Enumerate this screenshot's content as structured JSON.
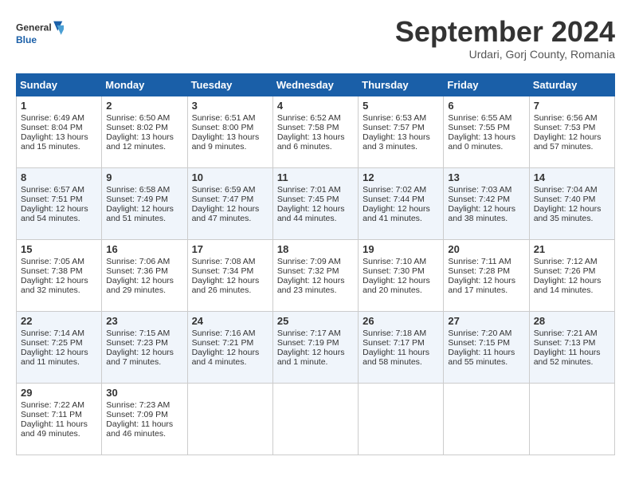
{
  "header": {
    "logo_line1": "General",
    "logo_line2": "Blue",
    "month": "September 2024",
    "location": "Urdari, Gorj County, Romania"
  },
  "weekdays": [
    "Sunday",
    "Monday",
    "Tuesday",
    "Wednesday",
    "Thursday",
    "Friday",
    "Saturday"
  ],
  "weeks": [
    [
      {
        "day": "1",
        "lines": [
          "Sunrise: 6:49 AM",
          "Sunset: 8:04 PM",
          "Daylight: 13 hours",
          "and 15 minutes."
        ]
      },
      {
        "day": "2",
        "lines": [
          "Sunrise: 6:50 AM",
          "Sunset: 8:02 PM",
          "Daylight: 13 hours",
          "and 12 minutes."
        ]
      },
      {
        "day": "3",
        "lines": [
          "Sunrise: 6:51 AM",
          "Sunset: 8:00 PM",
          "Daylight: 13 hours",
          "and 9 minutes."
        ]
      },
      {
        "day": "4",
        "lines": [
          "Sunrise: 6:52 AM",
          "Sunset: 7:58 PM",
          "Daylight: 13 hours",
          "and 6 minutes."
        ]
      },
      {
        "day": "5",
        "lines": [
          "Sunrise: 6:53 AM",
          "Sunset: 7:57 PM",
          "Daylight: 13 hours",
          "and 3 minutes."
        ]
      },
      {
        "day": "6",
        "lines": [
          "Sunrise: 6:55 AM",
          "Sunset: 7:55 PM",
          "Daylight: 13 hours",
          "and 0 minutes."
        ]
      },
      {
        "day": "7",
        "lines": [
          "Sunrise: 6:56 AM",
          "Sunset: 7:53 PM",
          "Daylight: 12 hours",
          "and 57 minutes."
        ]
      }
    ],
    [
      {
        "day": "8",
        "lines": [
          "Sunrise: 6:57 AM",
          "Sunset: 7:51 PM",
          "Daylight: 12 hours",
          "and 54 minutes."
        ]
      },
      {
        "day": "9",
        "lines": [
          "Sunrise: 6:58 AM",
          "Sunset: 7:49 PM",
          "Daylight: 12 hours",
          "and 51 minutes."
        ]
      },
      {
        "day": "10",
        "lines": [
          "Sunrise: 6:59 AM",
          "Sunset: 7:47 PM",
          "Daylight: 12 hours",
          "and 47 minutes."
        ]
      },
      {
        "day": "11",
        "lines": [
          "Sunrise: 7:01 AM",
          "Sunset: 7:45 PM",
          "Daylight: 12 hours",
          "and 44 minutes."
        ]
      },
      {
        "day": "12",
        "lines": [
          "Sunrise: 7:02 AM",
          "Sunset: 7:44 PM",
          "Daylight: 12 hours",
          "and 41 minutes."
        ]
      },
      {
        "day": "13",
        "lines": [
          "Sunrise: 7:03 AM",
          "Sunset: 7:42 PM",
          "Daylight: 12 hours",
          "and 38 minutes."
        ]
      },
      {
        "day": "14",
        "lines": [
          "Sunrise: 7:04 AM",
          "Sunset: 7:40 PM",
          "Daylight: 12 hours",
          "and 35 minutes."
        ]
      }
    ],
    [
      {
        "day": "15",
        "lines": [
          "Sunrise: 7:05 AM",
          "Sunset: 7:38 PM",
          "Daylight: 12 hours",
          "and 32 minutes."
        ]
      },
      {
        "day": "16",
        "lines": [
          "Sunrise: 7:06 AM",
          "Sunset: 7:36 PM",
          "Daylight: 12 hours",
          "and 29 minutes."
        ]
      },
      {
        "day": "17",
        "lines": [
          "Sunrise: 7:08 AM",
          "Sunset: 7:34 PM",
          "Daylight: 12 hours",
          "and 26 minutes."
        ]
      },
      {
        "day": "18",
        "lines": [
          "Sunrise: 7:09 AM",
          "Sunset: 7:32 PM",
          "Daylight: 12 hours",
          "and 23 minutes."
        ]
      },
      {
        "day": "19",
        "lines": [
          "Sunrise: 7:10 AM",
          "Sunset: 7:30 PM",
          "Daylight: 12 hours",
          "and 20 minutes."
        ]
      },
      {
        "day": "20",
        "lines": [
          "Sunrise: 7:11 AM",
          "Sunset: 7:28 PM",
          "Daylight: 12 hours",
          "and 17 minutes."
        ]
      },
      {
        "day": "21",
        "lines": [
          "Sunrise: 7:12 AM",
          "Sunset: 7:26 PM",
          "Daylight: 12 hours",
          "and 14 minutes."
        ]
      }
    ],
    [
      {
        "day": "22",
        "lines": [
          "Sunrise: 7:14 AM",
          "Sunset: 7:25 PM",
          "Daylight: 12 hours",
          "and 11 minutes."
        ]
      },
      {
        "day": "23",
        "lines": [
          "Sunrise: 7:15 AM",
          "Sunset: 7:23 PM",
          "Daylight: 12 hours",
          "and 7 minutes."
        ]
      },
      {
        "day": "24",
        "lines": [
          "Sunrise: 7:16 AM",
          "Sunset: 7:21 PM",
          "Daylight: 12 hours",
          "and 4 minutes."
        ]
      },
      {
        "day": "25",
        "lines": [
          "Sunrise: 7:17 AM",
          "Sunset: 7:19 PM",
          "Daylight: 12 hours",
          "and 1 minute."
        ]
      },
      {
        "day": "26",
        "lines": [
          "Sunrise: 7:18 AM",
          "Sunset: 7:17 PM",
          "Daylight: 11 hours",
          "and 58 minutes."
        ]
      },
      {
        "day": "27",
        "lines": [
          "Sunrise: 7:20 AM",
          "Sunset: 7:15 PM",
          "Daylight: 11 hours",
          "and 55 minutes."
        ]
      },
      {
        "day": "28",
        "lines": [
          "Sunrise: 7:21 AM",
          "Sunset: 7:13 PM",
          "Daylight: 11 hours",
          "and 52 minutes."
        ]
      }
    ],
    [
      {
        "day": "29",
        "lines": [
          "Sunrise: 7:22 AM",
          "Sunset: 7:11 PM",
          "Daylight: 11 hours",
          "and 49 minutes."
        ]
      },
      {
        "day": "30",
        "lines": [
          "Sunrise: 7:23 AM",
          "Sunset: 7:09 PM",
          "Daylight: 11 hours",
          "and 46 minutes."
        ]
      },
      {
        "day": "",
        "lines": []
      },
      {
        "day": "",
        "lines": []
      },
      {
        "day": "",
        "lines": []
      },
      {
        "day": "",
        "lines": []
      },
      {
        "day": "",
        "lines": []
      }
    ]
  ]
}
